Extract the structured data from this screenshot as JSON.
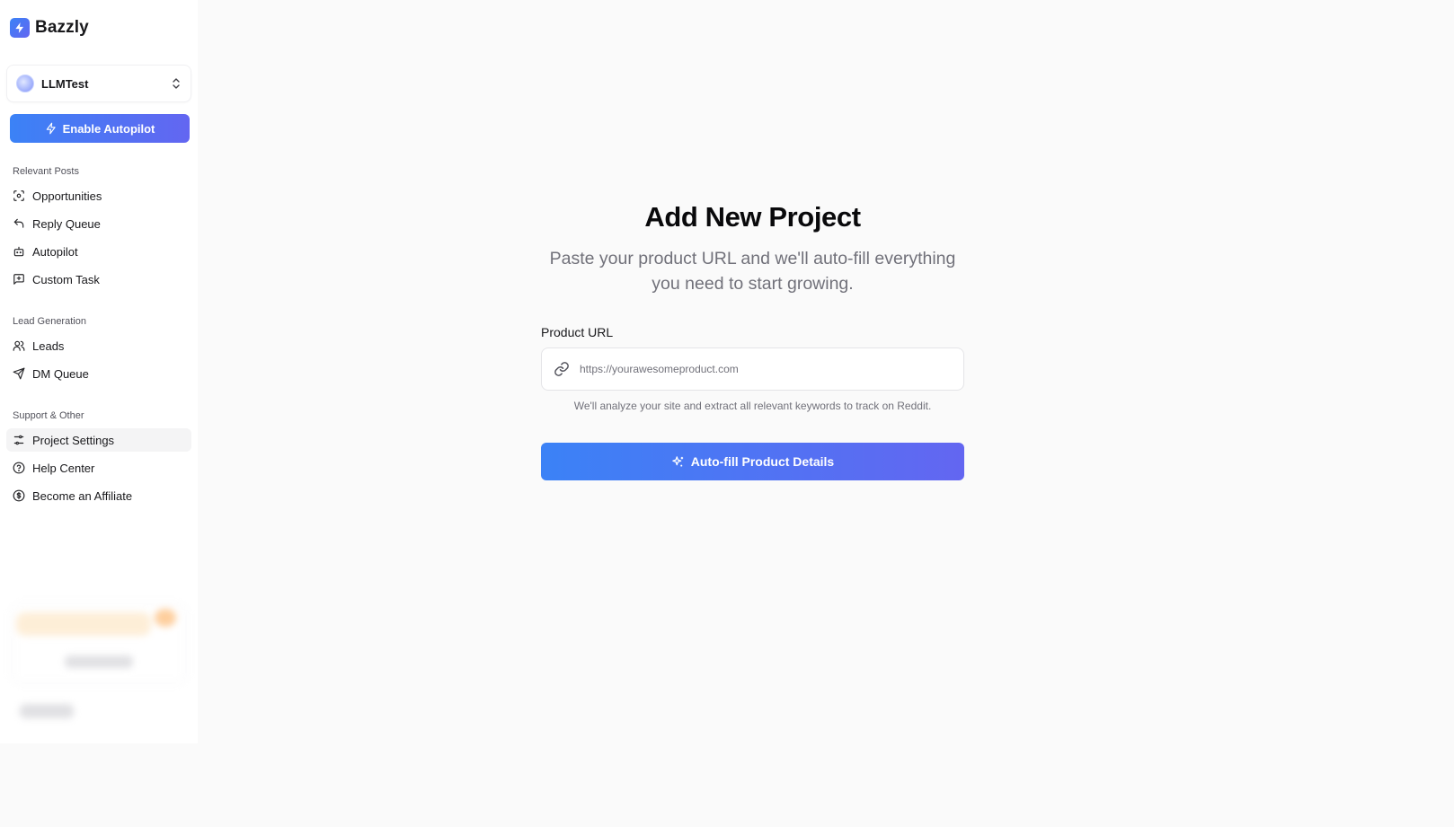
{
  "brand": {
    "name": "Bazzly",
    "logo_icon": "lightning-bolt-icon"
  },
  "project_switcher": {
    "name": "LLMTest",
    "icon": "chevrons-up-down-icon"
  },
  "autopilot_button": {
    "label": "Enable Autopilot",
    "icon": "lightning-icon"
  },
  "sidebar": {
    "sections": [
      {
        "title": "Relevant Posts",
        "items": [
          {
            "label": "Opportunities",
            "icon": "scan-face-icon"
          },
          {
            "label": "Reply Queue",
            "icon": "reply-arrow-icon"
          },
          {
            "label": "Autopilot",
            "icon": "bot-icon"
          },
          {
            "label": "Custom Task",
            "icon": "message-square-icon"
          }
        ]
      },
      {
        "title": "Lead Generation",
        "items": [
          {
            "label": "Leads",
            "icon": "users-icon"
          },
          {
            "label": "DM Queue",
            "icon": "send-icon"
          }
        ]
      },
      {
        "title": "Support & Other",
        "items": [
          {
            "label": "Project Settings",
            "icon": "sliders-icon",
            "active": true
          },
          {
            "label": "Help Center",
            "icon": "help-circle-icon"
          },
          {
            "label": "Become an Affiliate",
            "icon": "dollar-circle-icon"
          }
        ]
      }
    ]
  },
  "main": {
    "title": "Add New Project",
    "subtitle_line1": "Paste your product URL and we'll auto-fill everything",
    "subtitle_line2": "you need to start growing.",
    "url_field": {
      "label": "Product URL",
      "placeholder": "https://yourawesomeproduct.com",
      "value": "",
      "icon": "link-icon"
    },
    "help_text": "We'll analyze your site and extract all relevant keywords to track on Reddit.",
    "submit_button": {
      "label": "Auto-fill Product Details",
      "icon": "sparkles-icon"
    }
  },
  "colors": {
    "accent_start": "#3b82f6",
    "accent_end": "#6366f1",
    "background": "#fafafa",
    "sidebar_bg": "#ffffff"
  }
}
